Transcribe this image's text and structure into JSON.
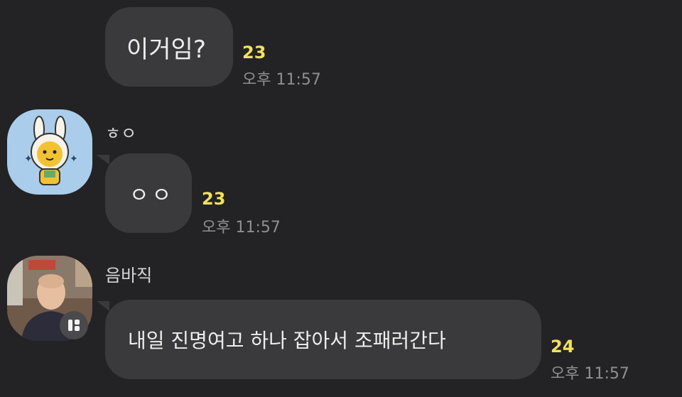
{
  "messages": [
    {
      "text": "이거임?",
      "unread": "23",
      "time": "오후 11:57"
    },
    {
      "sender": "ㅎㅇ",
      "text": "ㅇㅇ",
      "unread": "23",
      "time": "오후 11:57"
    },
    {
      "sender": "음바직",
      "text": "내일 진명여고 하나 잡아서 조패러간다",
      "unread": "24",
      "time": "오후 11:57"
    }
  ],
  "colors": {
    "background": "#232325",
    "bubble": "#3a3a3c",
    "unread": "#f2e25a",
    "time": "#8f8f92"
  },
  "icons": [
    "emoticon-avatar",
    "photo-avatar",
    "profile-badge-icon"
  ]
}
